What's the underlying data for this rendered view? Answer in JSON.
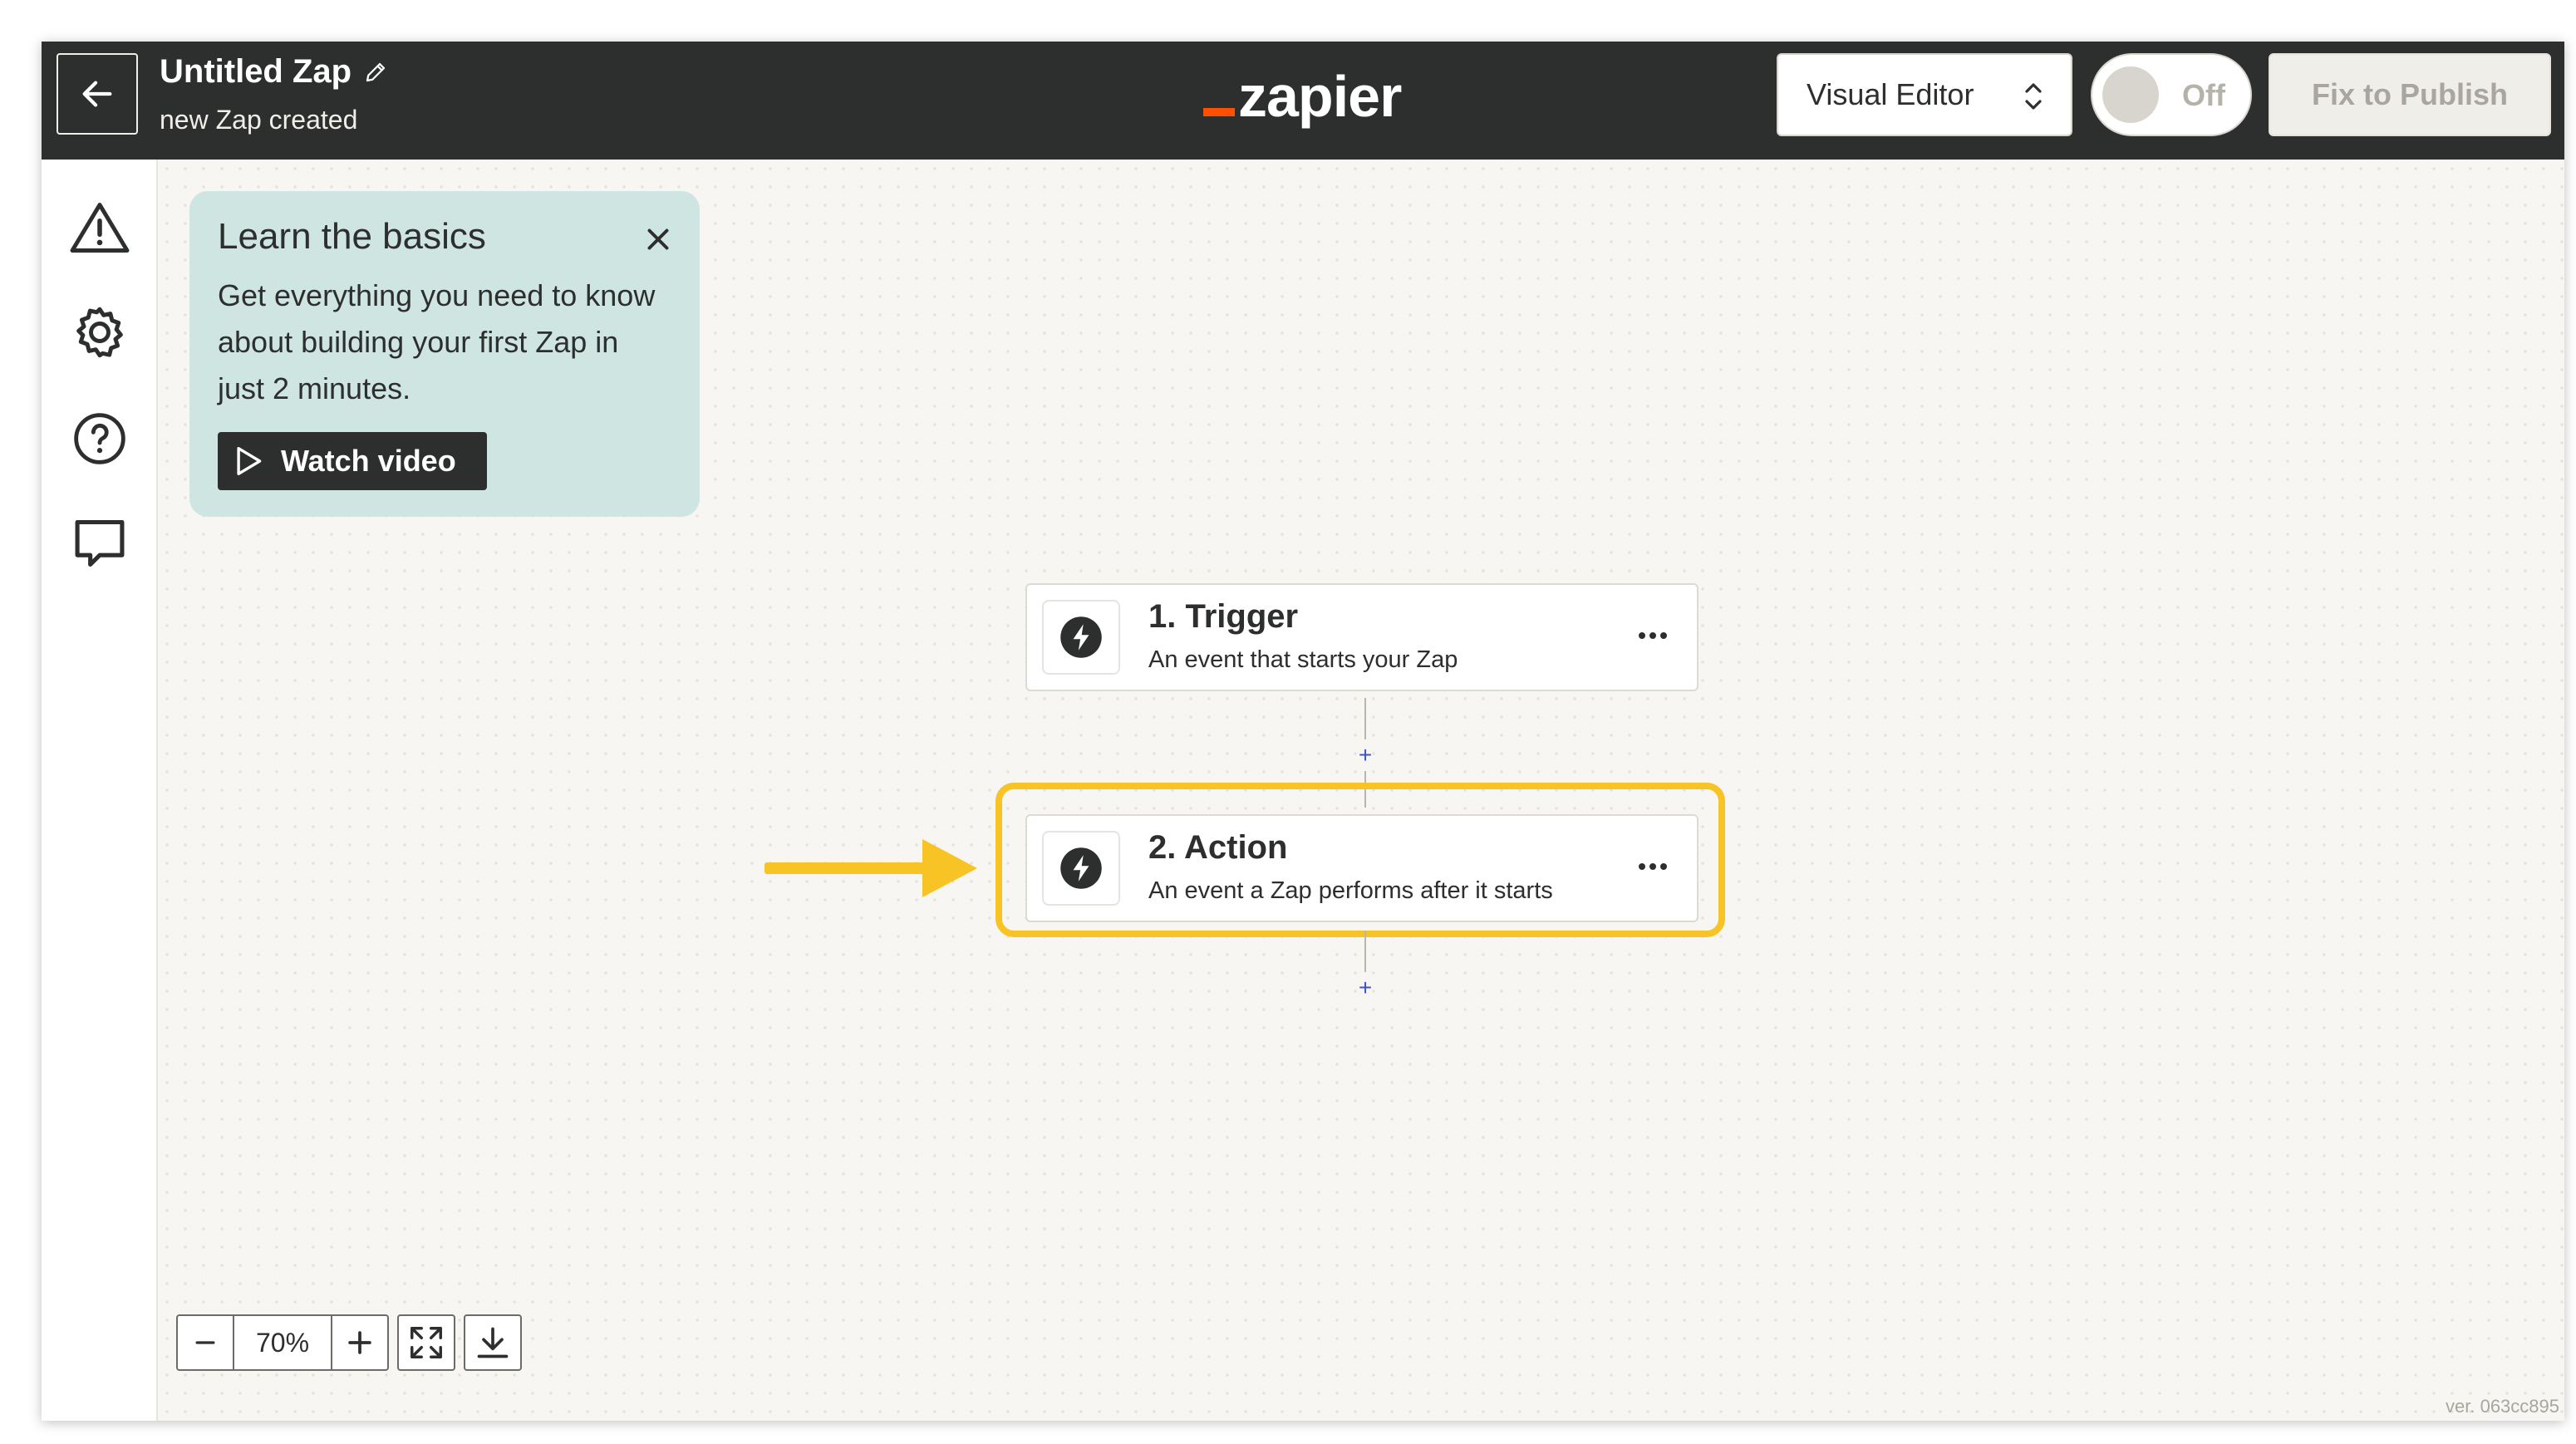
{
  "header": {
    "back_icon": "arrow-left-icon",
    "zap_title": "Untitled Zap",
    "edit_icon": "pencil-icon",
    "zap_subtitle": "new Zap created",
    "logo_text": "zapier",
    "editor_select_label": "Visual Editor",
    "toggle_label": "Off",
    "publish_label": "Fix to Publish"
  },
  "sidebar": {
    "icons": [
      "warning-icon",
      "gear-icon",
      "help-icon",
      "comment-icon"
    ]
  },
  "learn_card": {
    "title": "Learn the basics",
    "body": "Get everything you need to know about building your first Zap in just 2 minutes.",
    "button_label": "Watch video",
    "close_icon": "close-icon"
  },
  "steps": [
    {
      "title": "1. Trigger",
      "description": "An event that starts your Zap",
      "icon": "bolt-icon"
    },
    {
      "title": "2. Action",
      "description": "An event a Zap performs after it starts",
      "icon": "bolt-icon"
    }
  ],
  "add_step_symbol": "+",
  "zoom": {
    "level": "70%",
    "minus": "−",
    "plus": "+"
  },
  "version": "ver. 063cc895",
  "colors": {
    "topbar": "#2d2e2e",
    "brand_orange": "#ff4f00",
    "highlight": "#f7c325",
    "learn_card_bg": "#cfe5e1"
  }
}
